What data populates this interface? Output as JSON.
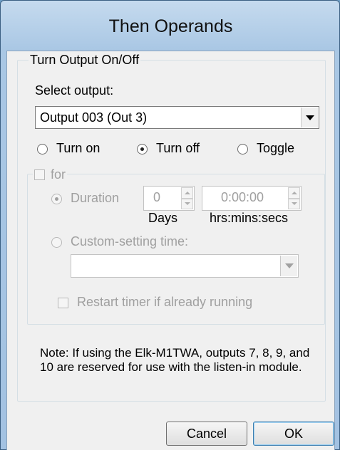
{
  "window": {
    "title": "Then Operands"
  },
  "group": {
    "legend": "Turn Output On/Off"
  },
  "select_output": {
    "label": "Select output:",
    "value": "Output 003 (Out 3)"
  },
  "actions": {
    "turn_on": "Turn on",
    "turn_off": "Turn off",
    "toggle": "Toggle",
    "selected": "turn_off"
  },
  "for_group": {
    "label": "for",
    "checked": false,
    "duration_label": "Duration",
    "days_value": "0",
    "days_unit": "Days",
    "time_value": "0:00:00",
    "time_unit": "hrs:mins:secs",
    "custom_label": "Custom-setting time:",
    "custom_value": "",
    "restart_label": "Restart timer if already running"
  },
  "note": "Note: If using the Elk-M1TWA, outputs 7, 8, 9, and 10 are reserved for use with the listen-in module.",
  "buttons": {
    "cancel": "Cancel",
    "ok": "OK"
  }
}
